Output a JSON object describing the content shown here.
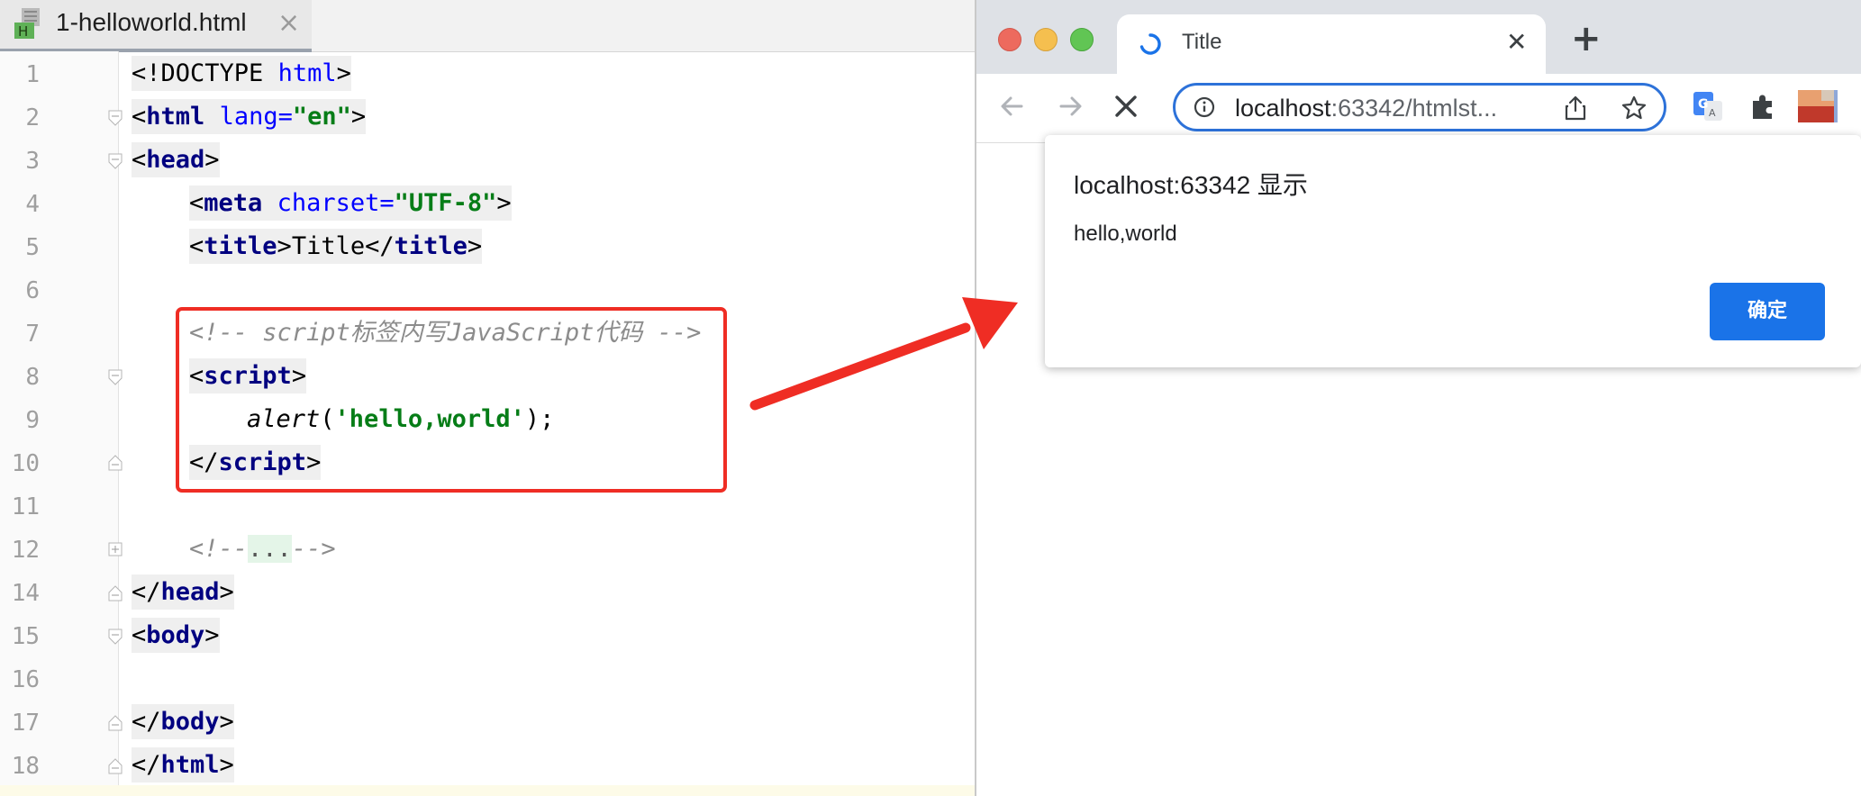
{
  "editor": {
    "tab": {
      "title": "1-helloworld.html",
      "file_icon_letter": "H",
      "close_glyph": "×"
    },
    "line_numbers": [
      "1",
      "2",
      "3",
      "4",
      "5",
      "6",
      "7",
      "8",
      "9",
      "10",
      "11",
      "12",
      "14",
      "15",
      "16",
      "17",
      "18"
    ],
    "lines": {
      "l1_open": "<!DOCTYPE ",
      "l1_html": "html",
      "l1_close": ">",
      "l2_lt": "<",
      "l2_tag": "html",
      "l2_sp": " ",
      "l2_attr": "lang",
      "l2_eq": "=",
      "l2_val": "\"en\"",
      "l2_gt": ">",
      "l3_lt": "<",
      "l3_tag": "head",
      "l3_gt": ">",
      "l4_lt": "<",
      "l4_tag": "meta",
      "l4_sp": " ",
      "l4_attr": "charset",
      "l4_eq": "=",
      "l4_val": "\"UTF-8\"",
      "l4_gt": ">",
      "l5_lt": "<",
      "l5_tag": "title",
      "l5_gt": ">",
      "l5_text": "Title",
      "l5_lt2": "</",
      "l5_tag2": "title",
      "l5_gt2": ">",
      "l7_comment": "<!-- script标签内写JavaScript代码 -->",
      "l8_lt": "<",
      "l8_tag": "script",
      "l8_gt": ">",
      "l9_fn": "alert",
      "l9_open": "(",
      "l9_str": "'hello,world'",
      "l9_close": ");",
      "l10_lt": "</",
      "l10_tag": "script",
      "l10_gt": ">",
      "l12_open": "<!--",
      "l12_dots": "...",
      "l12_close": "-->",
      "l14_lt": "</",
      "l14_tag": "head",
      "l14_gt": ">",
      "l15_lt": "<",
      "l15_tag": "body",
      "l15_gt": ">",
      "l17_lt": "</",
      "l17_tag": "body",
      "l17_gt": ">",
      "l18_lt": "</",
      "l18_tag": "html",
      "l18_gt": ">"
    }
  },
  "browser": {
    "tab": {
      "title": "Title",
      "close_glyph": "✕"
    },
    "new_tab_glyph": "+",
    "address": {
      "host": "localhost",
      "rest": ":63342/htmlst..."
    },
    "dialog": {
      "title": "localhost:63342 显示",
      "message": "hello,world",
      "ok_label": "确定"
    }
  },
  "colors": {
    "annotation_red": "#ef2d24",
    "accent_blue": "#1a73e8",
    "tag_navy": "#000080",
    "string_green": "#067d17"
  }
}
